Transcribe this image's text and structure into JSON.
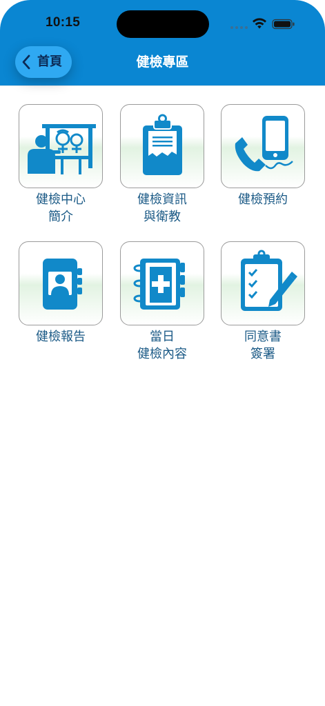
{
  "status_bar": {
    "time": "10:15"
  },
  "header": {
    "back_label": "首頁",
    "title": "健檢專區",
    "background_color": "#0a86d2",
    "back_button_color": "#2fa9f2"
  },
  "tiles": [
    {
      "icon": "presentation-board-icon",
      "label_lines": [
        "健檢中心",
        "簡介"
      ]
    },
    {
      "icon": "clipboard-document-icon",
      "label_lines": [
        "健檢資訊",
        "與衛教"
      ]
    },
    {
      "icon": "phone-appointment-icon",
      "label_lines": [
        "健檢預約"
      ]
    },
    {
      "icon": "contact-book-icon",
      "label_lines": [
        "健檢報告"
      ]
    },
    {
      "icon": "medical-binder-icon",
      "label_lines": [
        "當日",
        "健檢內容"
      ]
    },
    {
      "icon": "checklist-sign-icon",
      "label_lines": [
        "同意書",
        "簽署"
      ]
    }
  ],
  "colors": {
    "icon_blue": "#1189c9",
    "label_text": "#1b5a86"
  }
}
